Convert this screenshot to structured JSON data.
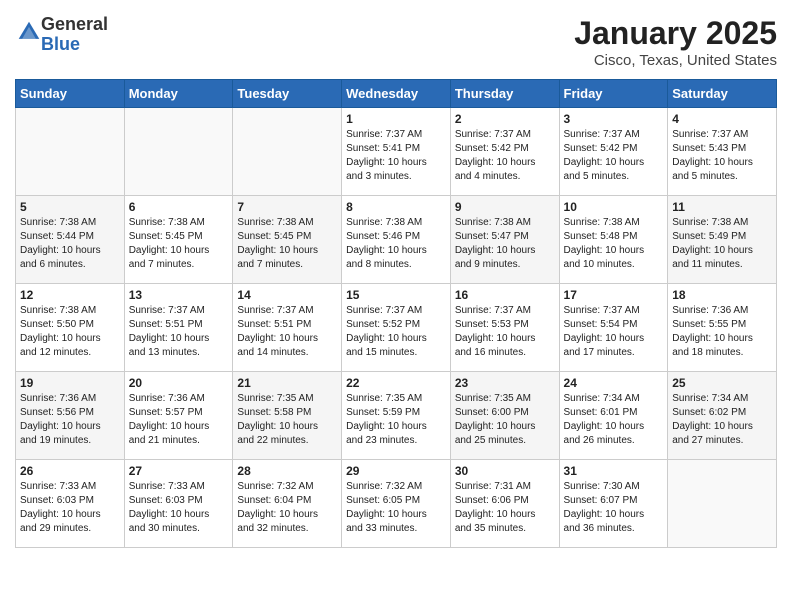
{
  "header": {
    "logo_line1": "General",
    "logo_line2": "Blue",
    "title": "January 2025",
    "subtitle": "Cisco, Texas, United States"
  },
  "days_of_week": [
    "Sunday",
    "Monday",
    "Tuesday",
    "Wednesday",
    "Thursday",
    "Friday",
    "Saturday"
  ],
  "weeks": [
    [
      {
        "day": "",
        "info": ""
      },
      {
        "day": "",
        "info": ""
      },
      {
        "day": "",
        "info": ""
      },
      {
        "day": "1",
        "info": "Sunrise: 7:37 AM\nSunset: 5:41 PM\nDaylight: 10 hours and 3 minutes."
      },
      {
        "day": "2",
        "info": "Sunrise: 7:37 AM\nSunset: 5:42 PM\nDaylight: 10 hours and 4 minutes."
      },
      {
        "day": "3",
        "info": "Sunrise: 7:37 AM\nSunset: 5:42 PM\nDaylight: 10 hours and 5 minutes."
      },
      {
        "day": "4",
        "info": "Sunrise: 7:37 AM\nSunset: 5:43 PM\nDaylight: 10 hours and 5 minutes."
      }
    ],
    [
      {
        "day": "5",
        "info": "Sunrise: 7:38 AM\nSunset: 5:44 PM\nDaylight: 10 hours and 6 minutes."
      },
      {
        "day": "6",
        "info": "Sunrise: 7:38 AM\nSunset: 5:45 PM\nDaylight: 10 hours and 7 minutes."
      },
      {
        "day": "7",
        "info": "Sunrise: 7:38 AM\nSunset: 5:45 PM\nDaylight: 10 hours and 7 minutes."
      },
      {
        "day": "8",
        "info": "Sunrise: 7:38 AM\nSunset: 5:46 PM\nDaylight: 10 hours and 8 minutes."
      },
      {
        "day": "9",
        "info": "Sunrise: 7:38 AM\nSunset: 5:47 PM\nDaylight: 10 hours and 9 minutes."
      },
      {
        "day": "10",
        "info": "Sunrise: 7:38 AM\nSunset: 5:48 PM\nDaylight: 10 hours and 10 minutes."
      },
      {
        "day": "11",
        "info": "Sunrise: 7:38 AM\nSunset: 5:49 PM\nDaylight: 10 hours and 11 minutes."
      }
    ],
    [
      {
        "day": "12",
        "info": "Sunrise: 7:38 AM\nSunset: 5:50 PM\nDaylight: 10 hours and 12 minutes."
      },
      {
        "day": "13",
        "info": "Sunrise: 7:37 AM\nSunset: 5:51 PM\nDaylight: 10 hours and 13 minutes."
      },
      {
        "day": "14",
        "info": "Sunrise: 7:37 AM\nSunset: 5:51 PM\nDaylight: 10 hours and 14 minutes."
      },
      {
        "day": "15",
        "info": "Sunrise: 7:37 AM\nSunset: 5:52 PM\nDaylight: 10 hours and 15 minutes."
      },
      {
        "day": "16",
        "info": "Sunrise: 7:37 AM\nSunset: 5:53 PM\nDaylight: 10 hours and 16 minutes."
      },
      {
        "day": "17",
        "info": "Sunrise: 7:37 AM\nSunset: 5:54 PM\nDaylight: 10 hours and 17 minutes."
      },
      {
        "day": "18",
        "info": "Sunrise: 7:36 AM\nSunset: 5:55 PM\nDaylight: 10 hours and 18 minutes."
      }
    ],
    [
      {
        "day": "19",
        "info": "Sunrise: 7:36 AM\nSunset: 5:56 PM\nDaylight: 10 hours and 19 minutes."
      },
      {
        "day": "20",
        "info": "Sunrise: 7:36 AM\nSunset: 5:57 PM\nDaylight: 10 hours and 21 minutes."
      },
      {
        "day": "21",
        "info": "Sunrise: 7:35 AM\nSunset: 5:58 PM\nDaylight: 10 hours and 22 minutes."
      },
      {
        "day": "22",
        "info": "Sunrise: 7:35 AM\nSunset: 5:59 PM\nDaylight: 10 hours and 23 minutes."
      },
      {
        "day": "23",
        "info": "Sunrise: 7:35 AM\nSunset: 6:00 PM\nDaylight: 10 hours and 25 minutes."
      },
      {
        "day": "24",
        "info": "Sunrise: 7:34 AM\nSunset: 6:01 PM\nDaylight: 10 hours and 26 minutes."
      },
      {
        "day": "25",
        "info": "Sunrise: 7:34 AM\nSunset: 6:02 PM\nDaylight: 10 hours and 27 minutes."
      }
    ],
    [
      {
        "day": "26",
        "info": "Sunrise: 7:33 AM\nSunset: 6:03 PM\nDaylight: 10 hours and 29 minutes."
      },
      {
        "day": "27",
        "info": "Sunrise: 7:33 AM\nSunset: 6:03 PM\nDaylight: 10 hours and 30 minutes."
      },
      {
        "day": "28",
        "info": "Sunrise: 7:32 AM\nSunset: 6:04 PM\nDaylight: 10 hours and 32 minutes."
      },
      {
        "day": "29",
        "info": "Sunrise: 7:32 AM\nSunset: 6:05 PM\nDaylight: 10 hours and 33 minutes."
      },
      {
        "day": "30",
        "info": "Sunrise: 7:31 AM\nSunset: 6:06 PM\nDaylight: 10 hours and 35 minutes."
      },
      {
        "day": "31",
        "info": "Sunrise: 7:30 AM\nSunset: 6:07 PM\nDaylight: 10 hours and 36 minutes."
      },
      {
        "day": "",
        "info": ""
      }
    ]
  ]
}
